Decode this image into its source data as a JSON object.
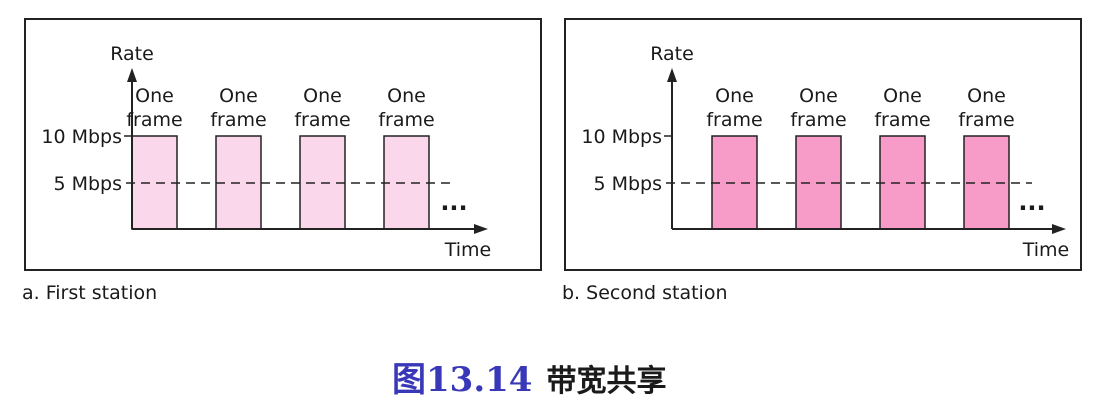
{
  "panels": [
    {
      "id": "a",
      "caption": "a. First station",
      "y_axis_label": "Rate",
      "x_axis_label": "Time",
      "y_ticks": [
        "10 Mbps",
        "5 Mbps"
      ],
      "frame_label_line1": "One",
      "frame_label_line2": "frame",
      "frame_count": 4,
      "frame_color": "#fad7ea",
      "continuation": "..."
    },
    {
      "id": "b",
      "caption": "b. Second station",
      "y_axis_label": "Rate",
      "x_axis_label": "Time",
      "y_ticks": [
        "10 Mbps",
        "5 Mbps"
      ],
      "frame_label_line1": "One",
      "frame_label_line2": "frame",
      "frame_count": 4,
      "frame_color": "#f79cc9",
      "continuation": "..."
    }
  ],
  "figure": {
    "number": "图13.14",
    "title": "带宽共享"
  }
}
